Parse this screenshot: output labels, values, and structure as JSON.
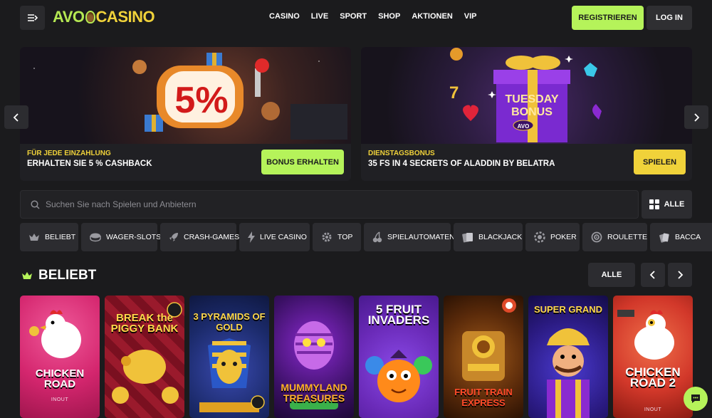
{
  "header": {
    "logo_left": "AVO",
    "logo_right": "CASINO",
    "nav": [
      "CASINO",
      "LIVE",
      "SPORT",
      "SHOP",
      "AKTIONEN",
      "VIP"
    ],
    "register_label": "REGISTRIEREN",
    "login_label": "LOG IN"
  },
  "banners": [
    {
      "kicker": "FÜR JEDE EINZAHLUNG",
      "headline": "ERHALTEN SIE 5 % CASHBACK",
      "cta": "BONUS ERHALTEN",
      "art_text": "5%"
    },
    {
      "kicker": "DIENSTAGSBONUS",
      "headline": "35 FS IN 4 SECRETS OF ALADDIN BY BELATRA",
      "cta": "SPIELEN",
      "art_text_1": "TUESDAY",
      "art_text_2": "BONUS",
      "art_text_3": "AVO"
    }
  ],
  "search": {
    "placeholder": "Suchen Sie nach Spielen und Anbietern"
  },
  "filter_all_label": "ALLE",
  "categories": [
    {
      "label": "BELIEBT",
      "icon": "crown-icon"
    },
    {
      "label": "WAGER-SLOTS",
      "icon": "chip-icon"
    },
    {
      "label": "CRASH-GAMES",
      "icon": "rocket-icon"
    },
    {
      "label": "LIVE CASINO",
      "icon": "lightning-icon"
    },
    {
      "label": "TOP",
      "icon": "gear-icon"
    },
    {
      "label": "SPIELAUTOMATEN",
      "icon": "cherry-icon"
    },
    {
      "label": "BLACKJACK",
      "icon": "cards-icon"
    },
    {
      "label": "POKER",
      "icon": "poker-chip-icon"
    },
    {
      "label": "ROULETTE",
      "icon": "roulette-icon"
    },
    {
      "label": "BACCA",
      "icon": "baccarat-icon"
    }
  ],
  "section": {
    "title": "BELIEBT",
    "all_label": "ALLE"
  },
  "games": [
    {
      "name": "CHICKEN ROAD",
      "provider": "INOUT",
      "bg": "#d4266e"
    },
    {
      "name": "BREAK the PIGGY BANK",
      "provider": "",
      "bg": "#7a1020"
    },
    {
      "name": "3 PYRAMIDS OF GOLD",
      "provider": "",
      "bg": "#1b2a6a"
    },
    {
      "name": "MUMMYLAND TREASURES",
      "provider": "",
      "bg": "#3a1064"
    },
    {
      "name": "5 FRUIT INVADERS",
      "provider": "",
      "bg": "#6a2ab8"
    },
    {
      "name": "FRUIT TRAIN EXPRESS",
      "provider": "",
      "bg": "#5a2a0a"
    },
    {
      "name": "SUPER GRAND",
      "provider": "",
      "bg": "#2a1a80"
    },
    {
      "name": "CHICKEN ROAD 2",
      "provider": "INOUT",
      "bg": "#d2382a"
    }
  ],
  "colors": {
    "accent_green": "#b5f35a",
    "accent_yellow": "#f0d23a",
    "background": "#1b1b1d"
  }
}
